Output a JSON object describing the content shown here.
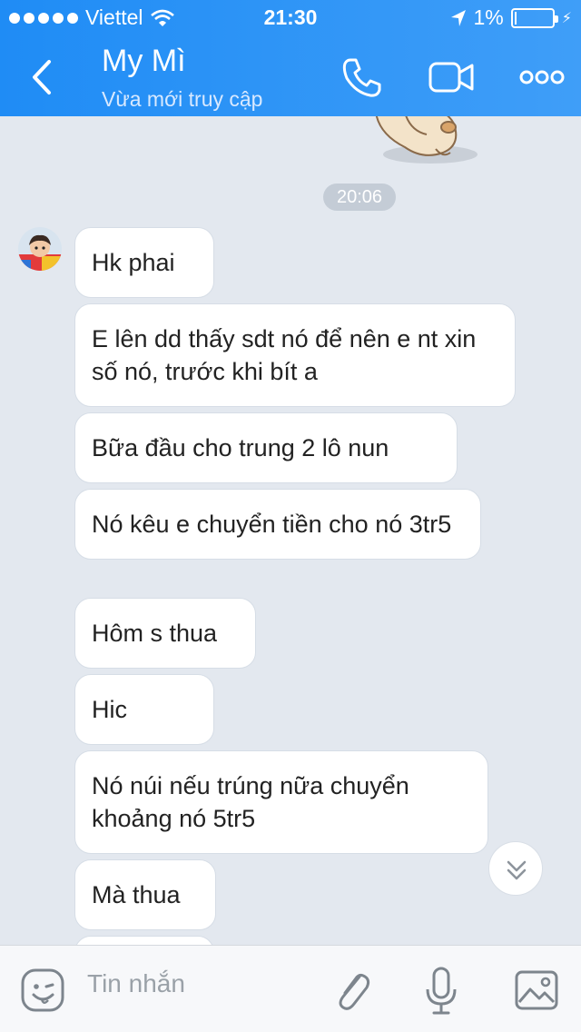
{
  "status_bar": {
    "carrier": "Viettel",
    "time": "21:30",
    "battery": "1%",
    "battery_level": 0.01
  },
  "header": {
    "title": "My Mì",
    "subtitle": "Vừa mới truy cập"
  },
  "chat": {
    "timestamp": "20:06",
    "messages": [
      "Hk phai",
      "E lên dd thấy sdt nó để nên e nt xin số nó, trước khi bít a",
      "Bữa đầu cho trung 2 lô nun",
      "Nó kêu e chuyển tiền cho nó 3tr5",
      "Hôm s thua",
      "Hic",
      "Nó núi nếu trúng nữa chuyển khoảng nó 5tr5",
      "Mà thua"
    ]
  },
  "composer": {
    "placeholder": "Tin nhắn"
  },
  "colors": {
    "header_blue": "#2a93f6",
    "chat_background": "#e3e8ef",
    "bubble": "#ffffff"
  },
  "icons": [
    "back-icon",
    "phone-icon",
    "video-icon",
    "more-icon",
    "emoji-icon",
    "attach-icon",
    "mic-icon",
    "image-icon",
    "chevron-double-down-icon"
  ]
}
